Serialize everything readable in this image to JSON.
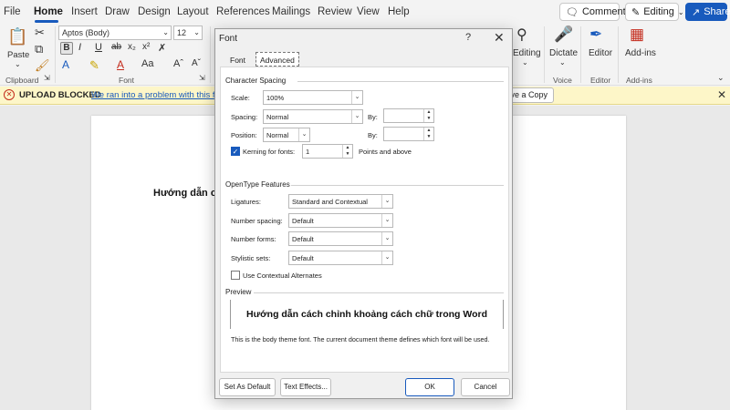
{
  "menu": {
    "tabs": [
      "File",
      "Home",
      "Insert",
      "Draw",
      "Design",
      "Layout",
      "References",
      "Mailings",
      "Review",
      "View",
      "Help"
    ],
    "active": "Home",
    "comments_label": "Comments",
    "editing_label": "Editing",
    "share_label": "Share"
  },
  "ribbon": {
    "paste_label": "Paste",
    "clipboard_label": "Clipboard",
    "font_label": "Font",
    "font_name": "Aptos (Body)",
    "font_size": "12",
    "editing_label": "Editing",
    "dictate_label": "Dictate",
    "voice_label": "Voice",
    "editor_label": "Editor",
    "editor_group_label": "Editor",
    "addins_label": "Add-ins",
    "addins_group_label": "Add-ins"
  },
  "blockbar": {
    "title": "UPLOAD BLOCKED",
    "message": "We ran into a problem with this file",
    "button": "ve a Copy"
  },
  "document": {
    "heading": "Hướng dẫn c"
  },
  "dialog": {
    "title": "Font",
    "help": "?",
    "tabs": {
      "font": "Font",
      "advanced": "Advanced"
    },
    "char_spacing": {
      "section": "Character Spacing",
      "scale_label": "Scale:",
      "scale_value": "100%",
      "spacing_label": "Spacing:",
      "spacing_value": "Normal",
      "spacing_by_label": "By:",
      "position_label": "Position:",
      "position_value": "Normal",
      "position_by_label": "By:",
      "kerning_label": "Kerning for fonts:",
      "kerning_value": "1",
      "kerning_checked": true,
      "points_label": "Points and above"
    },
    "opentype": {
      "section": "OpenType Features",
      "ligatures_label": "Ligatures:",
      "ligatures_value": "Standard and Contextual",
      "number_spacing_label": "Number spacing:",
      "number_spacing_value": "Default",
      "number_forms_label": "Number forms:",
      "number_forms_value": "Default",
      "stylistic_sets_label": "Stylistic sets:",
      "stylistic_sets_value": "Default",
      "contextual_alternates_label": "Use Contextual Alternates",
      "contextual_alternates_checked": false
    },
    "preview": {
      "section": "Preview",
      "sample": "Hướng dẫn cách chỉnh khoảng cách chữ trong Word",
      "note": "This is the body theme font. The current document theme defines which font will be used."
    },
    "buttons": {
      "set_default": "Set As Default",
      "text_effects": "Text Effects...",
      "ok": "OK",
      "cancel": "Cancel"
    }
  },
  "colors": {
    "accent": "#185abd",
    "warning_bg": "#fdf6c8",
    "error": "#c42b1c"
  }
}
